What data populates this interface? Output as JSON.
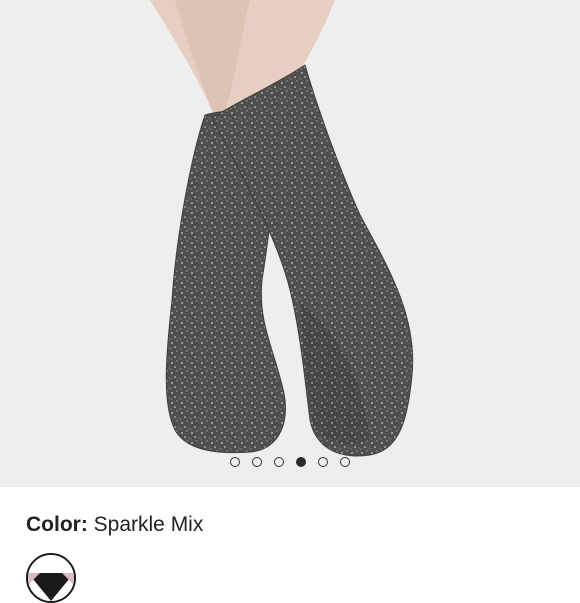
{
  "product": {
    "image_alt": "Sparkle mix fuzzy crew socks on feet",
    "carousel": {
      "count": 6,
      "active_index": 3
    },
    "color": {
      "label": "Color:",
      "value": "Sparkle Mix"
    },
    "swatches": [
      {
        "name": "Sparkle Mix",
        "selected": true
      }
    ]
  },
  "colors": {
    "background": "#ffffff",
    "image_background": "#eeeeec",
    "sock": "#5a5a58",
    "skin": "#e8d2c4",
    "dot_active": "#2b2b2b"
  }
}
